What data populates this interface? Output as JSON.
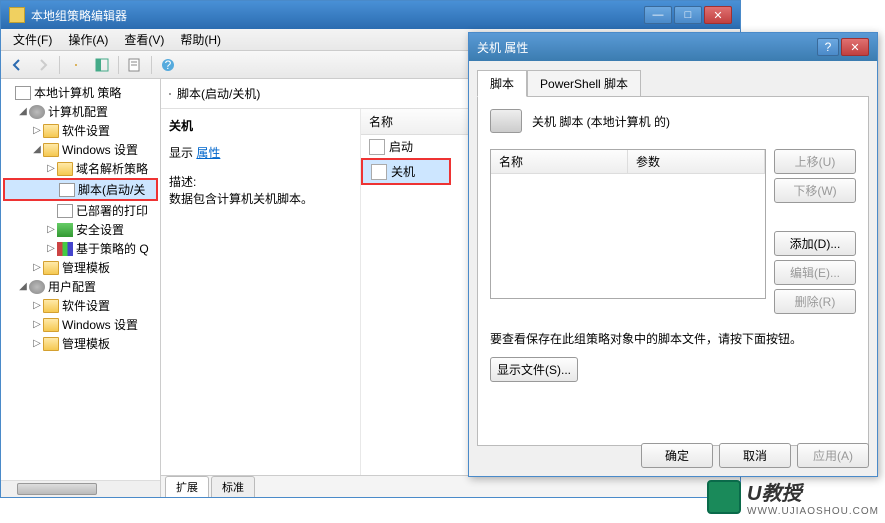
{
  "main": {
    "title": "本地组策略编辑器",
    "menus": [
      "文件(F)",
      "操作(A)",
      "查看(V)",
      "帮助(H)"
    ]
  },
  "tree": {
    "root": "本地计算机 策略",
    "computer_config": "计算机配置",
    "software_settings": "软件设置",
    "windows_settings": "Windows 设置",
    "dns_policy": "域名解析策略",
    "scripts": "脚本(启动/关",
    "deployed_printers": "已部署的打印",
    "security": "安全设置",
    "policy_based": "基于策略的 Q",
    "admin_templates": "管理模板",
    "user_config": "用户配置",
    "software_settings2": "软件设置",
    "windows_settings2": "Windows 设置",
    "admin_templates2": "管理模板"
  },
  "content": {
    "header": "脚本(启动/关机)",
    "section_title": "关机",
    "show_label": "显示",
    "properties_link": "属性",
    "description_label": "描述:",
    "description_text": "数据包含计算机关机脚本。",
    "name_col": "名称",
    "item_startup": "启动",
    "item_shutdown": "关机",
    "tab_extended": "扩展",
    "tab_standard": "标准"
  },
  "dialog": {
    "title": "关机 属性",
    "tab_scripts": "脚本",
    "tab_powershell": "PowerShell 脚本",
    "heading": "关机 脚本 (本地计算机 的)",
    "col_name": "名称",
    "col_params": "参数",
    "btn_up": "上移(U)",
    "btn_down": "下移(W)",
    "btn_add": "添加(D)...",
    "btn_edit": "编辑(E)...",
    "btn_remove": "删除(R)",
    "note": "要查看保存在此组策略对象中的脚本文件，请按下面按钮。",
    "btn_showfiles": "显示文件(S)...",
    "btn_ok": "确定",
    "btn_cancel": "取消",
    "btn_apply": "应用(A)"
  },
  "watermark": {
    "brand": "U教授",
    "url": "WWW.UJIAOSHOU.COM"
  }
}
